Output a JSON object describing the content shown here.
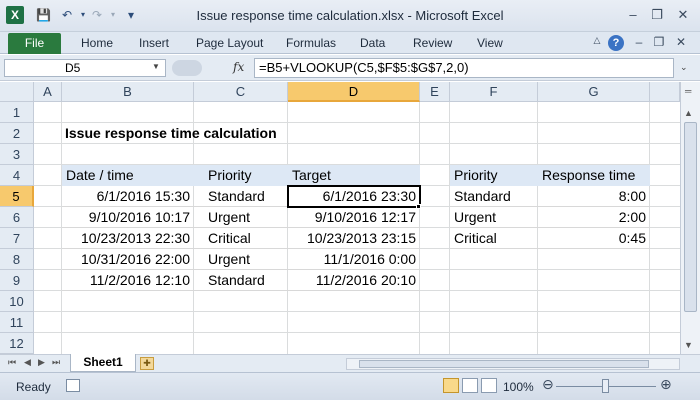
{
  "window": {
    "title": "Issue response time calculation.xlsx  -  Microsoft Excel",
    "app_letter": "X",
    "controls": {
      "minimize": "–",
      "restore": "❐",
      "close": "✕"
    }
  },
  "qat": {
    "save": "💾",
    "undo": "↶",
    "redo": "↷",
    "customize": "▾"
  },
  "ribbon": {
    "file_label": "File",
    "tabs": [
      "Home",
      "Insert",
      "Page Layout",
      "Formulas",
      "Data",
      "Review",
      "View"
    ],
    "help": "?"
  },
  "formula_bar": {
    "name_box": "D5",
    "fx": "fx",
    "formula": "=B5+VLOOKUP(C5,$F$5:$G$7,2,0)"
  },
  "grid": {
    "columns": [
      "A",
      "B",
      "C",
      "D",
      "E",
      "F",
      "G"
    ],
    "rows": [
      "1",
      "2",
      "3",
      "4",
      "5",
      "6",
      "7",
      "8",
      "9",
      "10",
      "11",
      "12"
    ],
    "selected_column": "D",
    "selected_row": "5",
    "active_cell": "D5",
    "sheet_title": "Issue response time calculation",
    "main_table": {
      "headers": [
        "Date / time",
        "Priority",
        "Target"
      ],
      "rows": [
        [
          "6/1/2016 15:30",
          "Standard",
          "6/1/2016 23:30"
        ],
        [
          "9/10/2016 10:17",
          "Urgent",
          "9/10/2016 12:17"
        ],
        [
          "10/23/2013 22:30",
          "Critical",
          "10/23/2013 23:15"
        ],
        [
          "10/31/2016 22:00",
          "Urgent",
          "11/1/2016 0:00"
        ],
        [
          "11/2/2016 12:10",
          "Standard",
          "11/2/2016 20:10"
        ]
      ]
    },
    "lookup_table": {
      "headers": [
        "Priority",
        "Response time"
      ],
      "rows": [
        [
          "Standard",
          "8:00"
        ],
        [
          "Urgent",
          "2:00"
        ],
        [
          "Critical",
          "0:45"
        ]
      ]
    },
    "header_fill_color": "#dde8f5",
    "selection_color": "#f7c96d"
  },
  "sheets": {
    "active": "Sheet1"
  },
  "status": {
    "ready": "Ready",
    "zoom": "100%",
    "zoom_level_percent": 100
  }
}
